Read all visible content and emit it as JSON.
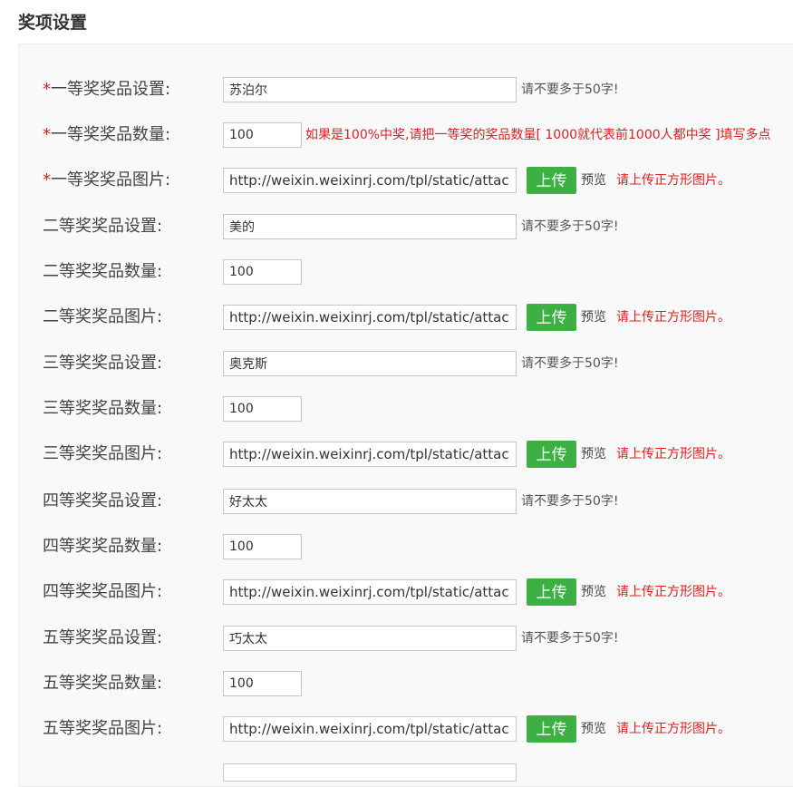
{
  "page": {
    "title": "奖项设置"
  },
  "rows": {
    "r1": {
      "required": "*",
      "label": "一等奖奖品设置:",
      "value": "苏泊尔",
      "hint": "请不要多于50字!"
    },
    "r2": {
      "required": "*",
      "label": "一等奖奖品数量:",
      "value": "100",
      "hint": "如果是100%中奖,请把一等奖的奖品数量[ 1000就代表前1000人都中奖 ]填写多点"
    },
    "r3": {
      "required": "*",
      "label": "一等奖奖品图片:",
      "value": "http://weixin.weixinrj.com/tpl/static/attachment",
      "upload": "上传",
      "preview": "预览",
      "hint": "请上传正方形图片。"
    },
    "r4": {
      "label": "二等奖奖品设置:",
      "value": "美的",
      "hint": "请不要多于50字!"
    },
    "r5": {
      "label": "二等奖奖品数量:",
      "value": "100"
    },
    "r6": {
      "label": "二等奖奖品图片:",
      "value": "http://weixin.weixinrj.com/tpl/static/attachment",
      "upload": "上传",
      "preview": "预览",
      "hint": "请上传正方形图片。"
    },
    "r7": {
      "label": "三等奖奖品设置:",
      "value": "奥克斯",
      "hint": "请不要多于50字!"
    },
    "r8": {
      "label": "三等奖奖品数量:",
      "value": "100"
    },
    "r9": {
      "label": "三等奖奖品图片:",
      "value": "http://weixin.weixinrj.com/tpl/static/attachment",
      "upload": "上传",
      "preview": "预览",
      "hint": "请上传正方形图片。"
    },
    "r10": {
      "label": "四等奖奖品设置:",
      "value": "好太太",
      "hint": "请不要多于50字!"
    },
    "r11": {
      "label": "四等奖奖品数量:",
      "value": "100"
    },
    "r12": {
      "label": "四等奖奖品图片:",
      "value": "http://weixin.weixinrj.com/tpl/static/attachment",
      "upload": "上传",
      "preview": "预览",
      "hint": "请上传正方形图片。"
    },
    "r13": {
      "label": "五等奖奖品设置:",
      "value": "巧太太",
      "hint": "请不要多于50字!"
    },
    "r14": {
      "label": "五等奖奖品数量:",
      "value": "100"
    },
    "r15": {
      "label": "五等奖奖品图片:",
      "value": "http://weixin.weixinrj.com/tpl/static/attachment",
      "upload": "上传",
      "preview": "预览",
      "hint": "请上传正方形图片。"
    }
  },
  "colors": {
    "required": "#e02020",
    "hint_red": "#e02020",
    "upload_button": "#3cb043",
    "panel_bg": "#f9f9f9"
  }
}
